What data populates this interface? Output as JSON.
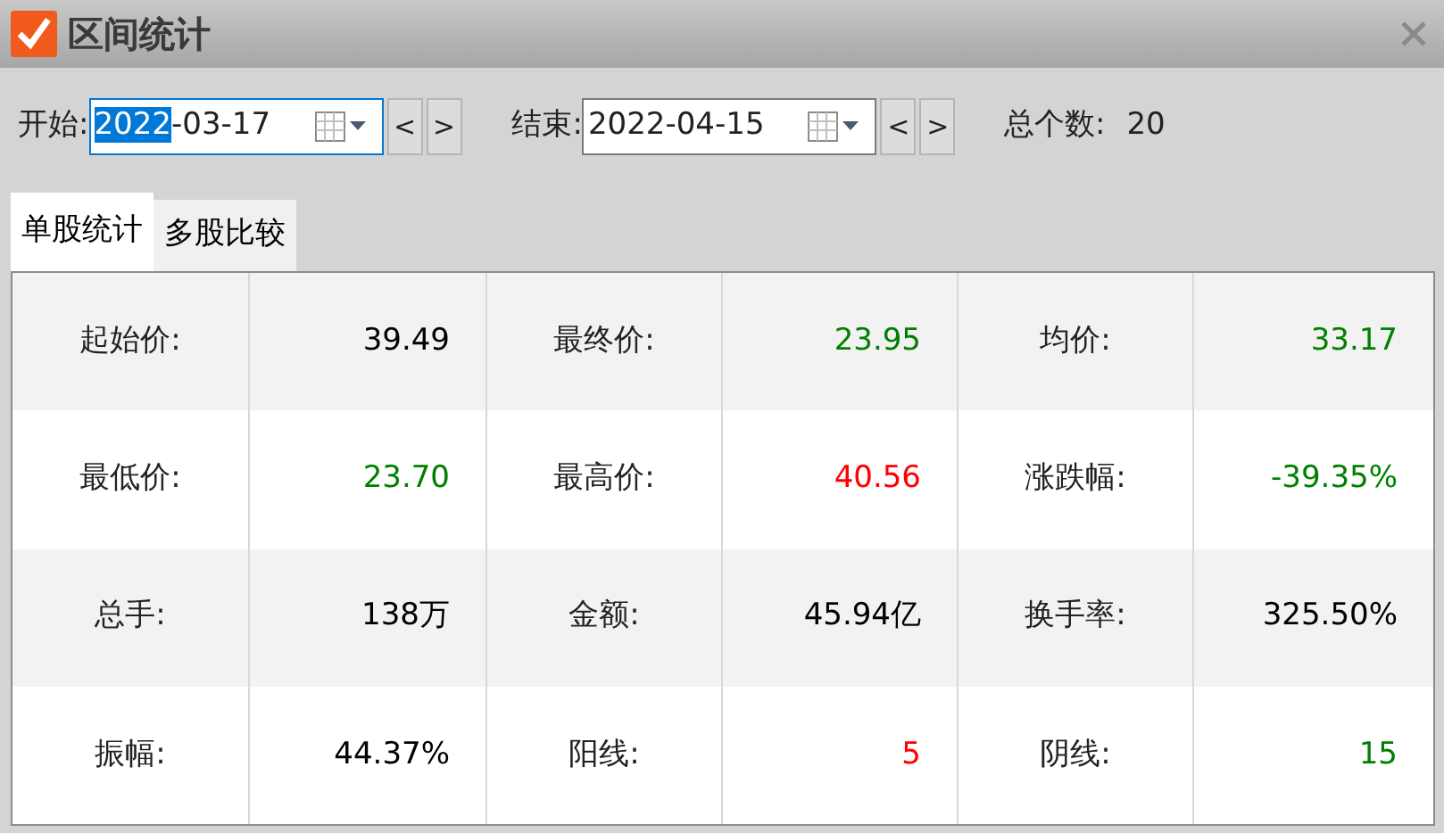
{
  "window": {
    "title": "区间统计"
  },
  "toolbar": {
    "start_label": "开始:",
    "start_field": {
      "parts": [
        {
          "text": "2022",
          "selected": true
        },
        {
          "text": "-03-17",
          "selected": false
        }
      ]
    },
    "end_label": "结束:",
    "end_field": {
      "parts": [
        {
          "text": "2022-04-15",
          "selected": false
        }
      ]
    },
    "prev_button": "<",
    "next_button": ">",
    "count_label": "总个数:",
    "count_value": "20"
  },
  "tabs": [
    {
      "label": "单股统计",
      "selected": true
    },
    {
      "label": "多股比较",
      "selected": false
    }
  ],
  "table": {
    "rows": [
      [
        {
          "label": "起始价:",
          "value": "39.49",
          "color": "#000000"
        },
        {
          "label": "最终价:",
          "value": "23.95",
          "color": "#008000"
        },
        {
          "label": "均价:",
          "value": "33.17",
          "color": "#008000"
        }
      ],
      [
        {
          "label": "最低价:",
          "value": "23.70",
          "color": "#008000"
        },
        {
          "label": "最高价:",
          "value": "40.56",
          "color": "#ff0000"
        },
        {
          "label": "涨跌幅:",
          "value": "-39.35%",
          "color": "#008000"
        }
      ],
      [
        {
          "label": "总手:",
          "value": "138万",
          "color": "#000000"
        },
        {
          "label": "金额:",
          "value": "45.94亿",
          "color": "#000000"
        },
        {
          "label": "换手率:",
          "value": "325.50%",
          "color": "#000000"
        }
      ],
      [
        {
          "label": "振幅:",
          "value": "44.37%",
          "color": "#000000"
        },
        {
          "label": "阳线:",
          "value": "5",
          "color": "#ff0000"
        },
        {
          "label": "阴线:",
          "value": "15",
          "color": "#008000"
        }
      ]
    ]
  }
}
